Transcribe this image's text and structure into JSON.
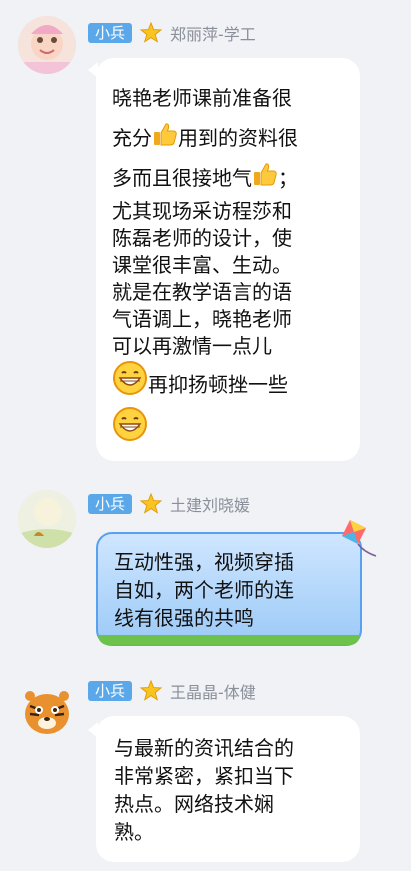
{
  "messages": [
    {
      "badge": "小兵",
      "sender": "郑丽萍-学工",
      "lines": [
        "晓艳老师课前准备很",
        "充分",
        "用到的资料很",
        "多而且很接地气",
        "；",
        "尤其现场采访程莎和",
        "陈磊老师的设计，使",
        "课堂很丰富、生动。",
        "就是在教学语言的语",
        "气语调上，晓艳老师",
        "可以再激情一点儿",
        "再抑扬顿挫一些"
      ]
    },
    {
      "badge": "小兵",
      "sender": "土建刘晓媛",
      "lines": [
        "互动性强，视频穿插",
        "自如，两个老师的连",
        "线有很强的共鸣"
      ]
    },
    {
      "badge": "小兵",
      "sender": "王晶晶-体健",
      "lines": [
        "与最新的资讯结合的",
        "非常紧密，紧扣当下",
        "热点。网络技术娴",
        "熟。"
      ]
    }
  ],
  "colors": {
    "badge": "#5aa8ea",
    "sender": "#8a8f99",
    "bubble": "#ffffff",
    "blue_bubble_border": "#5aa0f0",
    "background": "#f1f2f6"
  },
  "icons": [
    "star-icon",
    "thumbs-up-icon",
    "grin-emoji-icon",
    "kite-icon",
    "avatar-baby",
    "avatar-garden",
    "avatar-tiger"
  ]
}
